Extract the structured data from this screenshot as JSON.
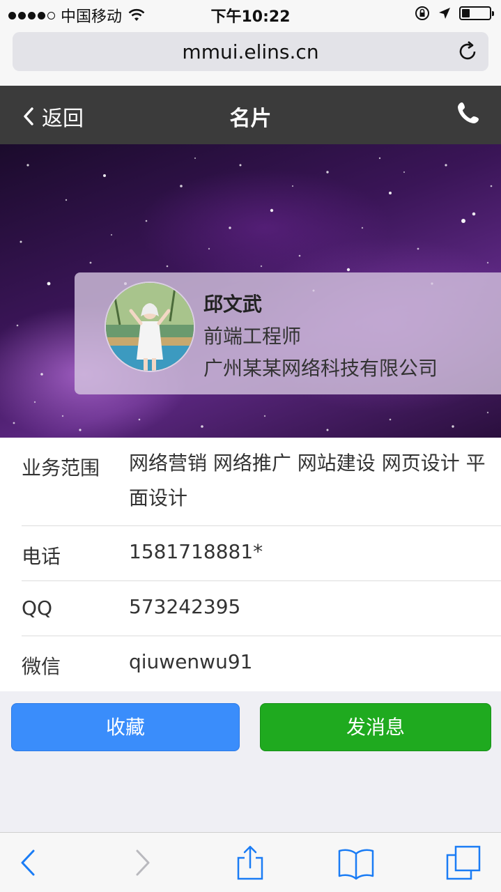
{
  "status_bar": {
    "carrier": "中国移动",
    "time": "下午10:22",
    "battery_level": 0.3
  },
  "browser": {
    "url": "mmui.elins.cn"
  },
  "navbar": {
    "back_label": "返回",
    "title": "名片"
  },
  "profile": {
    "name": "邱文武",
    "job_title": "前端工程师",
    "company": "广州某某网络科技有限公司"
  },
  "info": [
    {
      "label": "业务范围",
      "value": "网络营销 网络推广 网站建设 网页设计 平面设计"
    },
    {
      "label": "电话",
      "value": "1581718881*"
    },
    {
      "label": "QQ",
      "value": "573242395"
    },
    {
      "label": "微信",
      "value": "qiuwenwu91"
    }
  ],
  "actions": {
    "favorite_label": "收藏",
    "message_label": "发消息"
  },
  "colors": {
    "navbar_bg": "#3b3b3b",
    "favorite_btn": "#3a8dfb",
    "message_btn": "#1faa1f",
    "toolbar_icon": "#1a7cf5"
  },
  "icons": [
    "wifi-icon",
    "lock-rotation-icon",
    "location-arrow-icon",
    "battery-icon",
    "reload-icon",
    "back-chevron-icon",
    "phone-icon",
    "back-icon",
    "forward-icon",
    "share-icon",
    "bookmarks-icon",
    "tabs-icon"
  ]
}
